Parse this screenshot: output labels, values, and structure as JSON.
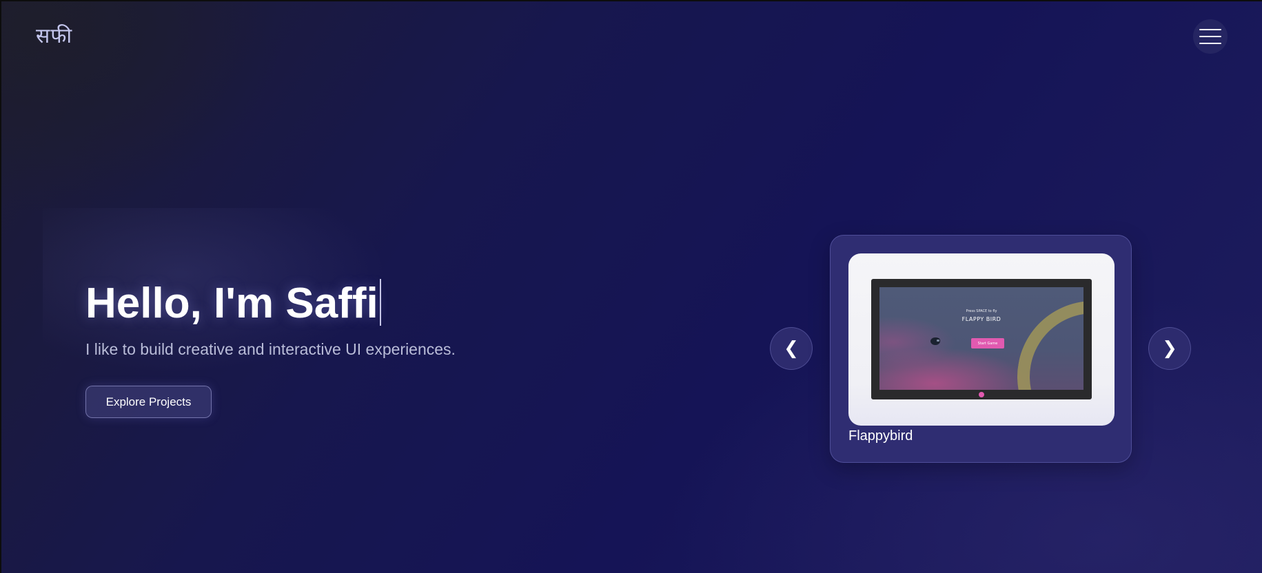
{
  "header": {
    "logo_text": "सफी",
    "menu_icon": "hamburger-menu-icon"
  },
  "hero": {
    "title": "Hello, I'm Saffi",
    "subtitle": "I like to build creative and interactive UI experiences.",
    "cta_label": "Explore Projects"
  },
  "carousel": {
    "prev_label": "❮",
    "next_label": "❯",
    "current_project": {
      "title": "Flappybird",
      "thumbnail": {
        "prompt_small": "Press SPACE to fly",
        "prompt_title": "FLAPPY BIRD",
        "start_label": "Start Game"
      }
    }
  },
  "colors": {
    "background": "#16164a",
    "card": "#2f2d72",
    "accent_pink": "#e15ab0",
    "logo": "#c4c6ee"
  }
}
